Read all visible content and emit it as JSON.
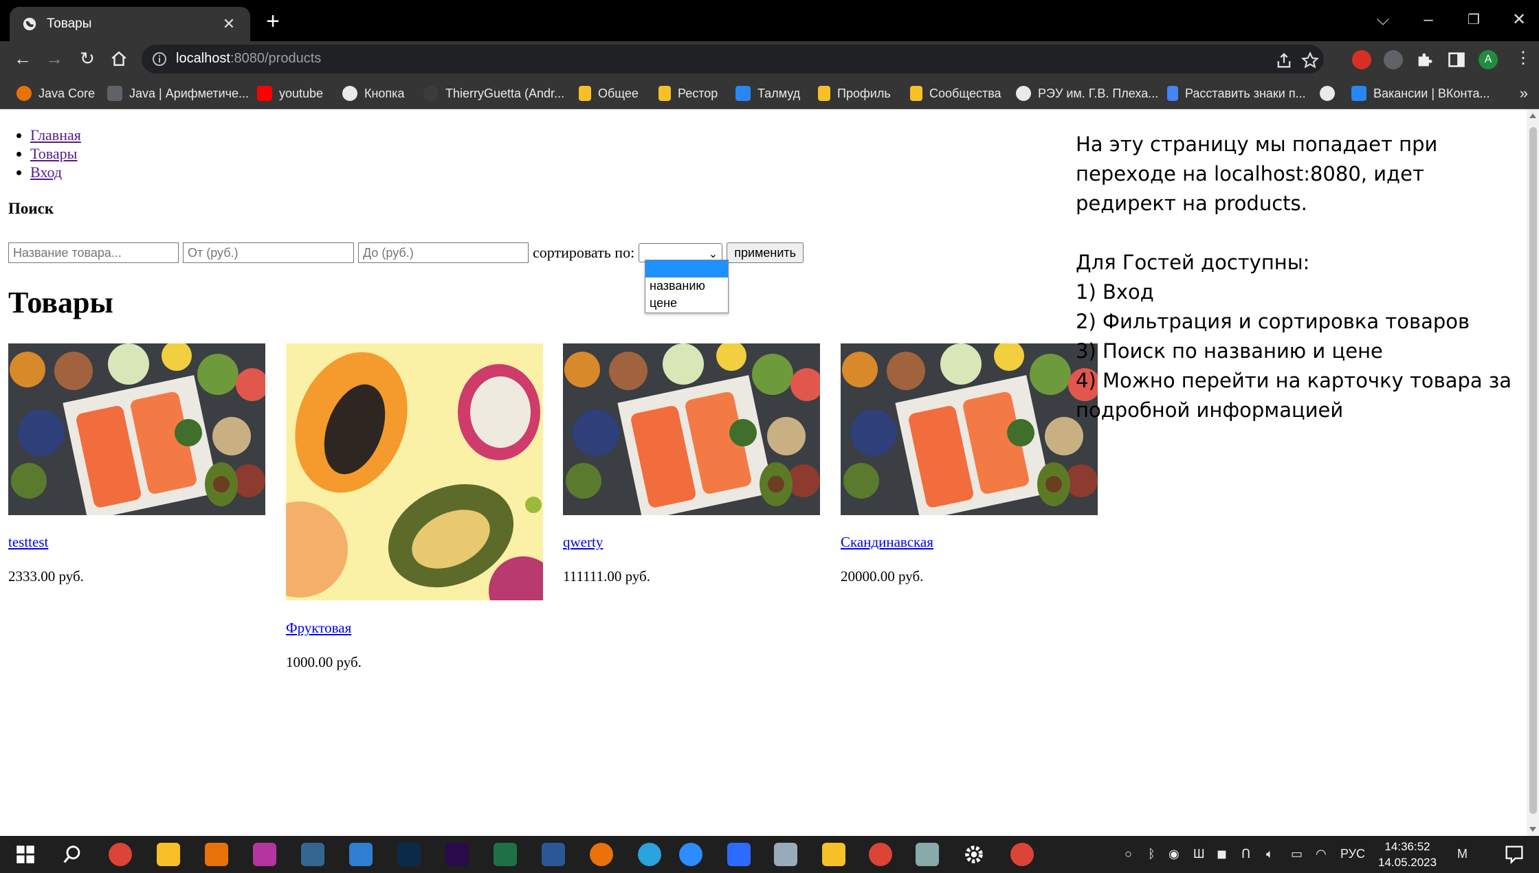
{
  "browser": {
    "tab_title": "Товары",
    "url_host": "localhost",
    "url_path": ":8080/products",
    "bookmarks": [
      {
        "label": "Java Core",
        "color": "#e8710a"
      },
      {
        "label": "Java | Арифметиче...",
        "color": "#5f6368"
      },
      {
        "label": "youtube",
        "color": "#ff0000"
      },
      {
        "label": "Кнопка",
        "color": "#9aa0a6"
      },
      {
        "label": "ThierryGuetta (Andr...",
        "color": "#3c3c3c"
      },
      {
        "label": "Общее",
        "color": "#f6c026"
      },
      {
        "label": "Рестор",
        "color": "#f6c026"
      },
      {
        "label": "Талмуд",
        "color": "#2787f5"
      },
      {
        "label": "Профиль",
        "color": "#f6c026"
      },
      {
        "label": "Сообщества",
        "color": "#f6c026"
      },
      {
        "label": "РЭУ им. Г.В. Плеха...",
        "color": "#9aa0a6"
      },
      {
        "label": "Расставить знаки п...",
        "color": "#4285f4"
      },
      {
        "label": "",
        "color": "#9aa0a6"
      },
      {
        "label": "Вакансии | ВКонта...",
        "color": "#2787f5"
      }
    ]
  },
  "nav": {
    "home": "Главная",
    "products": "Товары",
    "login": "Вход"
  },
  "search": {
    "title": "Поиск",
    "name_placeholder": "Название товара...",
    "from_placeholder": "От (руб.)",
    "to_placeholder": "До (руб.)",
    "sort_label": "сортировать по:",
    "sort_selected": "",
    "sort_options": [
      "",
      "названию",
      "цене"
    ],
    "apply_label": "применить"
  },
  "products": {
    "title": "Товары",
    "items": [
      {
        "name": "testtest",
        "price": "2333.00 руб.",
        "image": "salmon"
      },
      {
        "name": "Фруктовая",
        "price": "1000.00 руб.",
        "image": "fruits"
      },
      {
        "name": "qwerty",
        "price": "111111.00 руб.",
        "image": "salmon"
      },
      {
        "name": "Скандинавская",
        "price": "20000.00 руб.",
        "image": "salmon"
      }
    ]
  },
  "note": {
    "line1": "На эту страницу мы попадает при переходе на localhost:8080, идет редирект на products.",
    "line2": "Для Гостей доступны:",
    "line3": "1) Вход",
    "line4": "2) Фильтрация и сортировка товаров",
    "line5": "3) Поиск по названию и цене",
    "line6": "4) Можно перейти на карточку товара за подробной информацией"
  },
  "taskbar": {
    "lang": "РУС",
    "time": "14:36:52",
    "date": "14.05.2023"
  }
}
